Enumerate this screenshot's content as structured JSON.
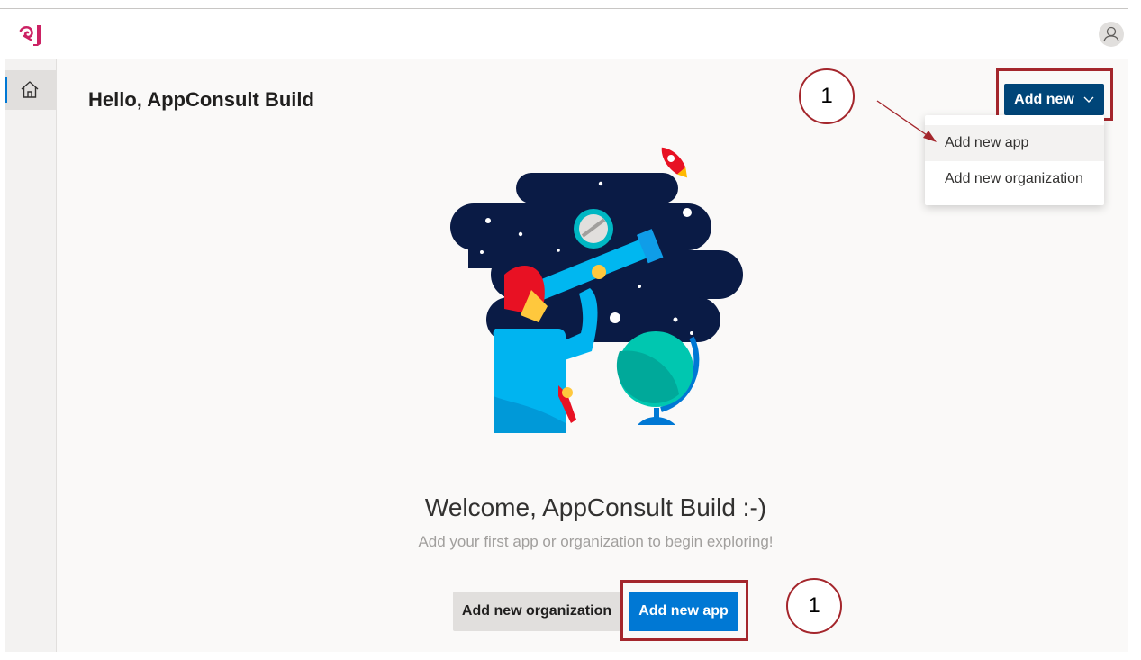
{
  "header": {
    "logo_icon": "app-center-logo-icon",
    "avatar_icon": "user-avatar-icon"
  },
  "sidebar": {
    "items": [
      {
        "icon": "home-icon",
        "active": true
      }
    ]
  },
  "main": {
    "greeting": "Hello, AppConsult Build",
    "add_new_label": "Add new",
    "dropdown": {
      "items": [
        {
          "label": "Add new app",
          "highlighted": true
        },
        {
          "label": "Add new organization",
          "highlighted": false
        }
      ]
    },
    "welcome_title": "Welcome, AppConsult Build :-)",
    "welcome_subtitle": "Add your first app or organization to begin exploring!",
    "buttons": {
      "add_org": "Add new organization",
      "add_app": "Add new app"
    }
  },
  "annotations": {
    "callout_top": "1",
    "callout_bottom": "1",
    "highlight_color": "#a4262c"
  },
  "colors": {
    "primary": "#0078d4",
    "primary_dark": "#004578",
    "logo": "#cc2264"
  }
}
